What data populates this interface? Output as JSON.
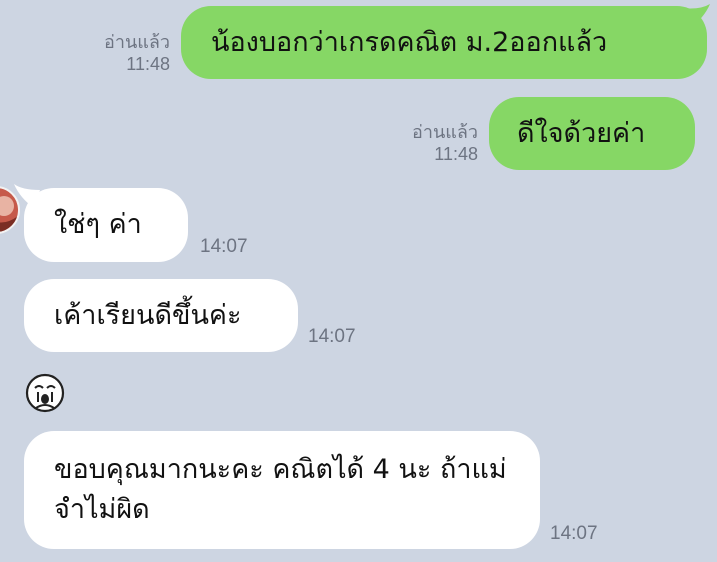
{
  "chat": {
    "messages": [
      {
        "side": "sent",
        "text": "น้องบอกว่าเกรดคณิต ม.2ออกแล้ว",
        "read": "อ่านแล้ว",
        "time": "11:48"
      },
      {
        "side": "sent",
        "text": "ดีใจด้วยค่า",
        "read": "อ่านแล้ว",
        "time": "11:48"
      },
      {
        "side": "received",
        "text": "ใช่ๆ ค่า",
        "time": "14:07"
      },
      {
        "side": "received",
        "text": "เค้าเรียนดีขึ้นค่ะ",
        "time": "14:07"
      },
      {
        "side": "received",
        "type": "sticker",
        "icon": "crying-face-sticker-icon"
      },
      {
        "side": "received",
        "text": "ขอบคุณมากนะคะ คณิตได้ 4 นะ ถ้าแม่จำไม่ผิด",
        "time": "14:07"
      }
    ]
  },
  "colors": {
    "background": "#cdd5e2",
    "sent_bubble": "#86d765",
    "received_bubble": "#ffffff",
    "meta_text": "#6d7482"
  }
}
